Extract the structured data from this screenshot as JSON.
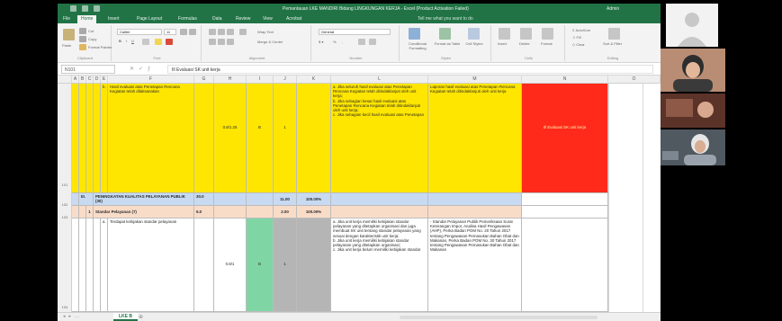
{
  "window": {
    "title": "Pemantauan LKE MANDIRI Bidang LINGKUNGAN KERJA - Excel (Product Activation Failed)",
    "user": "Admin"
  },
  "ribbon": {
    "tabs": [
      "File",
      "Home",
      "Insert",
      "Page Layout",
      "Formulas",
      "Data",
      "Review",
      "View",
      "Acrobat"
    ],
    "active_tab": "Home",
    "tell_me": "Tell me what you want to do",
    "font_name": "Calibri",
    "font_size": "11",
    "number_format": "General",
    "groups": [
      "Clipboard",
      "Font",
      "Alignment",
      "Number",
      "Styles",
      "Cells",
      "Editing"
    ],
    "buttons": {
      "paste": "Paste",
      "cut": "Cut",
      "copy": "Copy",
      "format_painter": "Format Painter",
      "wrap_text": "Wrap Text",
      "merge_center": "Merge & Center",
      "conditional_formatting": "Conditional Formatting",
      "format_as_table": "Format as Table",
      "cell_styles": "Cell Styles",
      "insert": "Insert",
      "delete": "Delete",
      "format": "Format",
      "autosum": "AutoSum",
      "fill": "Fill",
      "clear": "Clear",
      "sort_filter": "Sort & Filter"
    }
  },
  "formula_bar": {
    "name_box": "N101",
    "formula": "Ill Evaluasi SK unit kerja"
  },
  "columns": [
    "A",
    "B",
    "C",
    "D",
    "E",
    "F",
    "G",
    "H",
    "I",
    "J",
    "K",
    "L",
    "M",
    "N",
    "O"
  ],
  "rows": [
    "101",
    "102",
    "103",
    "104"
  ],
  "cells": {
    "r101_label": "b.",
    "r101_desc": "Hasil evaluasi atas Penetapan Rencana Kegiatan telah dilaksanakan",
    "r101_h": "0.8/1.25",
    "r101_i": "B",
    "r101_j": "1",
    "r101_l": "a. Jika seluruh hasil evaluasi atas Penetapan Rencana Kegiatan telah ditindaklanjuti oleh unit kerja;\nb. Jika sebagian besar hasil evaluasi atas Penetapan Rencana Kegiatan telah ditindaklanjuti oleh unit kerja;\nc. Jika sebagian kecil hasil evaluasi atas Penetapan",
    "r101_m": "Laporan hasil evaluasi atas Penetapan Rencana Kegiatan telah ditindaklanjuti oleh unit kerja",
    "r101_n": "Ill Evaluasi SK unit kerja",
    "r102_num": "III.",
    "r102_title": "PENINGKATAN KUALITAS PELAYANAN PUBLIK (30)",
    "r102_g": "30.0",
    "r102_j": "11.00",
    "r102_k": "100.00%",
    "r103_num": "1",
    "r103_title": "Standar Pelayanan (7)",
    "r103_g": "5.0",
    "r103_j": "2.00",
    "r103_k": "100.00%",
    "r104_label": "a.",
    "r104_desc": "Terdapat kebijakan standar pelayanan",
    "r104_h": "0.8/1",
    "r104_i": "B",
    "r104_j": "1",
    "r104_l": "a. Jika unit kerja memiliki kebijakan standar pelayanan yang ditetapkan organisasi dan juga membuat SK unit tentang standar pelayanan yang sesuai dengan karakteristik unit kerja;\nb. Jika unit kerja memiliki kebijakan standar pelayanan yang ditetapkan organisasi;\nc. Jika unit kerja belum memiliki kebijakan standar",
    "r104_m": "- Standar Pelayanan Publik Pemeriksaan Surat Keterangan Impor, Analisa Hasil Pengawasan (AHP), Perka Badan POM No. 20 Tahun 2017 tentang Pengawasan Pemasukan Bahan Obat dan Makanan, Perka Badan POM No. 30 Tahun 2017 tentang Pengawasan Pemasukan Bahan Obat dan Makanan"
  },
  "sheet_tab": "LKE B",
  "colors": {
    "excel_green": "#217346",
    "highlight_yellow": "#ffe600",
    "highlight_red": "#ff2a1a",
    "header_blue": "#c7daf2",
    "header_peach": "#f9dcc8",
    "cell_green": "#7fd6a4",
    "cell_gray": "#b5b5b5"
  }
}
